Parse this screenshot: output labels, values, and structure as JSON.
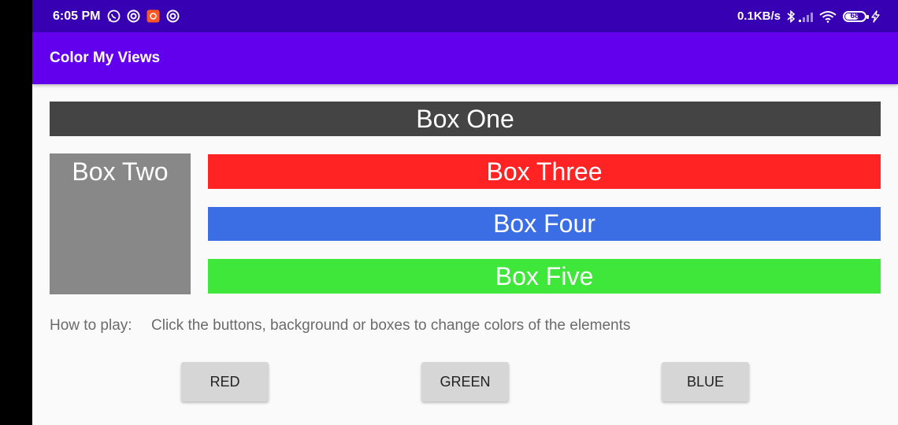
{
  "status_bar": {
    "time": "6:05 PM",
    "left_icons": [
      "whatsapp-icon",
      "sync-icon",
      "app-notification-icon",
      "sync-icon"
    ],
    "net_speed": "0.1KB/s",
    "battery": "68",
    "right_icons": [
      "bluetooth-icon",
      "signal-icon",
      "wifi-icon",
      "battery-icon",
      "charging-icon"
    ],
    "background": "#3700b3"
  },
  "app_bar": {
    "title": "Color My Views",
    "background": "#6200ee"
  },
  "boxes": [
    {
      "label": "Box One",
      "color": "#444444"
    },
    {
      "label": "Box Two",
      "color": "#888888"
    },
    {
      "label": "Box Three",
      "color": "#ff2323"
    },
    {
      "label": "Box Four",
      "color": "#3b6de4"
    },
    {
      "label": "Box Five",
      "color": "#3ee73a"
    }
  ],
  "instructions": {
    "label": "How to play:",
    "text": "Click the buttons, background or boxes to change colors of the elements"
  },
  "buttons": [
    {
      "label": "RED"
    },
    {
      "label": "GREEN"
    },
    {
      "label": "BLUE"
    }
  ]
}
